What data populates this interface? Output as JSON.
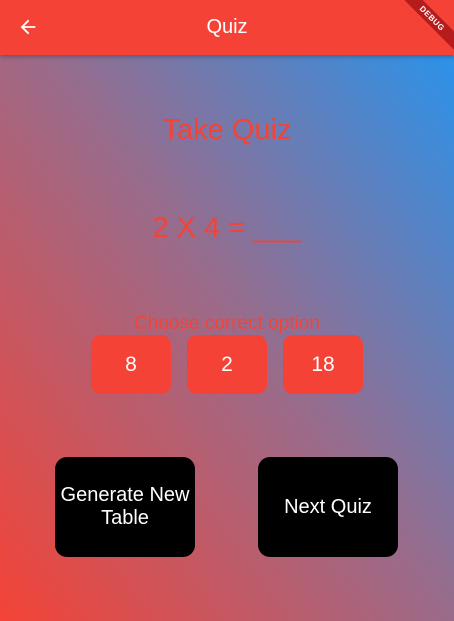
{
  "appbar": {
    "title": "Quiz",
    "back_icon": "arrow-left-icon",
    "debug_label": "DEBUG",
    "color": "#f44336"
  },
  "quiz": {
    "heading": "Take Quiz",
    "question": "2 X 4 = ___",
    "instruction": "Choose correct option",
    "options": [
      "8",
      "2",
      "18"
    ]
  },
  "actions": {
    "generate_label": "Generate New Table",
    "next_label": "Next Quiz"
  },
  "colors": {
    "accent": "#f44336",
    "gradient_start": "#f44336",
    "gradient_end": "#2196f3",
    "button_dark": "#000000"
  }
}
